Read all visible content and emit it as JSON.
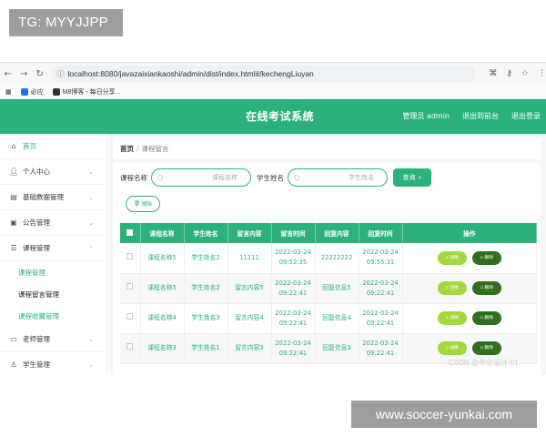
{
  "overlay": {
    "top_label": "TG: MYYJJPP",
    "bottom_label": "www.soccer-yunkai.com",
    "watermark": "CSDN @毕业设计-01"
  },
  "browser": {
    "url": "localhost:8080/javazaixiankaoshi/admin/dist/index.html#/kechengLiuyan",
    "bookmarks": [
      {
        "label": "必应",
        "icon": "bing-icon"
      },
      {
        "label": "M8博客 - 每日分享...",
        "icon": "blog-icon"
      }
    ]
  },
  "header": {
    "title": "在线考试系统",
    "links": [
      "管理员 admin",
      "退出到前台",
      "退出登录"
    ]
  },
  "sidebar": {
    "items": [
      {
        "label": "首页",
        "icon": "home-icon",
        "has_chevron": false
      },
      {
        "label": "个人中心",
        "icon": "user-icon",
        "has_chevron": true
      },
      {
        "label": "基础数据管理",
        "icon": "database-icon",
        "has_chevron": true
      },
      {
        "label": "公告管理",
        "icon": "notice-icon",
        "has_chevron": true
      },
      {
        "label": "课程管理",
        "icon": "course-icon",
        "has_chevron": true,
        "expanded": true
      }
    ],
    "sub_items": [
      "课程管理",
      "课程留言管理",
      "课程收藏管理"
    ],
    "items_after": [
      {
        "label": "老师管理",
        "icon": "teacher-icon",
        "has_chevron": true
      },
      {
        "label": "学生管理",
        "icon": "student-icon",
        "has_chevron": true
      }
    ]
  },
  "breadcrumb": {
    "home": "首页",
    "current": "课程留言"
  },
  "search": {
    "course_label": "课程名称",
    "course_placeholder": "课程名称",
    "student_label": "学生姓名",
    "student_placeholder": "学生姓名",
    "query_button": "查询",
    "delete_button": "删除"
  },
  "table": {
    "columns": [
      "课程名称",
      "学生姓名",
      "留言内容",
      "留言时间",
      "回复内容",
      "回复时间",
      "操作"
    ],
    "detail_label": "详情",
    "delete_label": "删除",
    "rows": [
      {
        "course": "课程名称5",
        "student": "学生姓名2",
        "content": "11111",
        "time": "2022-03-24 09:52:35",
        "reply": "22222222",
        "reply_time": "2022-03-24 09:55:31"
      },
      {
        "course": "课程名称5",
        "student": "学生姓名2",
        "content": "留言内容5",
        "time": "2022-03-24 09:22:41",
        "reply": "回复信息5",
        "reply_time": "2022-03-24 09:22:41"
      },
      {
        "course": "课程名称4",
        "student": "学生姓名3",
        "content": "留言内容4",
        "time": "2022-03-24 09:22:41",
        "reply": "回复信息4",
        "reply_time": "2022-03-24 09:22:41"
      },
      {
        "course": "课程名称3",
        "student": "学生姓名1",
        "content": "留言内容3",
        "time": "2022-03-24 09:22:41",
        "reply": "回复信息3",
        "reply_time": "2022-03-24 09:22:41"
      }
    ]
  },
  "colors": {
    "brand_green": "#2bb17b",
    "detail_button": "#a3d83f",
    "delete_button": "#2f6f1f"
  }
}
